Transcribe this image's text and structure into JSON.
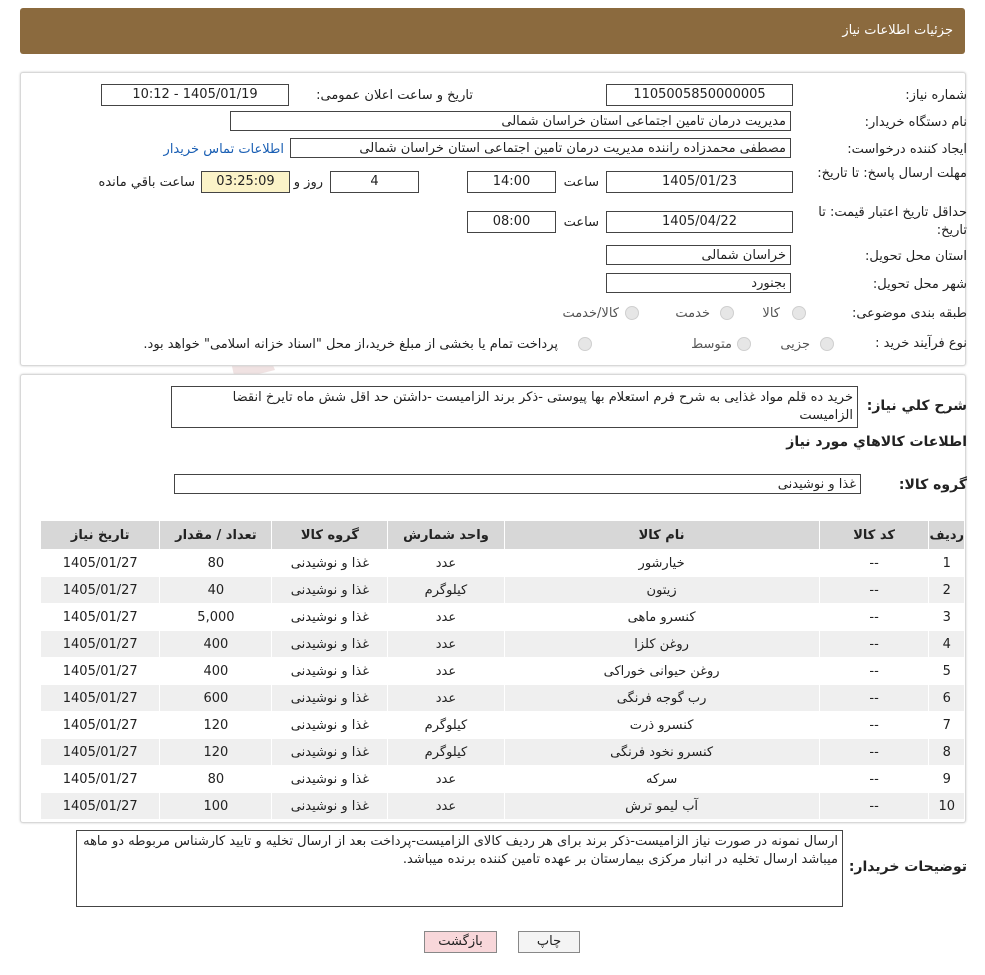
{
  "header": {
    "title": "جزئیات اطلاعات نیاز"
  },
  "fields": {
    "need_number_label": "شماره نیاز:",
    "need_number": "1105005850000005",
    "announce_label": "تاریخ و ساعت اعلان عمومی:",
    "announce_value": "1405/01/19 - 10:12",
    "buyer_org_label": "نام دستگاه خريدار:",
    "buyer_org": "مدیریت درمان تامین اجتماعی استان خراسان شمالی",
    "creator_label": "ایجاد کننده درخواست:",
    "creator": "مصطفی محمدزاده راننده مدیریت درمان تامین اجتماعی استان خراسان شمالی",
    "contact_link": "اطلاعات تماس خریدار",
    "reply_deadline_label": "مهلت ارسال پاسخ: تا تاریخ:",
    "reply_date": "1405/01/23",
    "time_label": "ساعت",
    "reply_time": "14:00",
    "days": "4",
    "days_label": "روز و",
    "remaining": "03:25:09",
    "remaining_label": "ساعت باقي مانده",
    "min_validity_label": "حداقل تاریخ اعتبار قیمت: تا تاریخ:",
    "validity_date": "1405/04/22",
    "validity_time": "08:00",
    "province_label": "استان محل تحویل:",
    "province": "خراسان شمالی",
    "city_label": "شهر محل تحویل:",
    "city": "بجنورد",
    "category_label": "طبقه بندی موضوعی:",
    "category_options": [
      "کالا",
      "خدمت",
      "کالا/خدمت"
    ],
    "process_label": "نوع فرآیند خرید :",
    "process_options": [
      "جزیی",
      "متوسط"
    ],
    "process_note": "پرداخت تمام یا بخشی از مبلغ خرید،از محل \"اسناد خزانه اسلامی\" خواهد بود."
  },
  "summary": {
    "desc_label": "شرح کلي نياز:",
    "desc": "خرید ده قلم مواد غذایی به شرح فرم استعلام بها پیوستی -ذکر برند الزامیست -داشتن حد اقل شش ماه تایرخ انقضا الزامیست",
    "goods_info_title": "اطلاعات کالاهاي مورد نياز",
    "group_label": "گروه کالا:",
    "group_value": "غذا و نوشیدنی"
  },
  "table": {
    "headers": [
      "رديف",
      "کد کالا",
      "نام کالا",
      "واحد شمارش",
      "گروه کالا",
      "تعداد / مقدار",
      "تاریخ نیاز"
    ],
    "rows": [
      [
        "1",
        "--",
        "خیارشور",
        "عدد",
        "غذا و نوشیدنی",
        "80",
        "1405/01/27"
      ],
      [
        "2",
        "--",
        "زیتون",
        "کیلوگرم",
        "غذا و نوشیدنی",
        "40",
        "1405/01/27"
      ],
      [
        "3",
        "--",
        "کنسرو ماهی",
        "عدد",
        "غذا و نوشیدنی",
        "5,000",
        "1405/01/27"
      ],
      [
        "4",
        "--",
        "روغن کلزا",
        "عدد",
        "غذا و نوشیدنی",
        "400",
        "1405/01/27"
      ],
      [
        "5",
        "--",
        "روغن حیوانی خوراکی",
        "عدد",
        "غذا و نوشیدنی",
        "400",
        "1405/01/27"
      ],
      [
        "6",
        "--",
        "رب گوجه فرنگی",
        "عدد",
        "غذا و نوشیدنی",
        "600",
        "1405/01/27"
      ],
      [
        "7",
        "--",
        "کنسرو ذرت",
        "کیلوگرم",
        "غذا و نوشیدنی",
        "120",
        "1405/01/27"
      ],
      [
        "8",
        "--",
        "کنسرو نخود فرنگی",
        "کیلوگرم",
        "غذا و نوشیدنی",
        "120",
        "1405/01/27"
      ],
      [
        "9",
        "--",
        "سرکه",
        "عدد",
        "غذا و نوشیدنی",
        "80",
        "1405/01/27"
      ],
      [
        "10",
        "--",
        "آب لیمو ترش",
        "عدد",
        "غذا و نوشیدنی",
        "100",
        "1405/01/27"
      ]
    ]
  },
  "buyer_notes": {
    "label": "توضیحات خریدار:",
    "text": "ارسال نمونه در صورت نیاز الزامیست-ذکر برند برای هر ردیف کالای الزامیست-پرداخت بعد از ارسال تخلیه و تایید کارشناس مربوطه دو ماهه میباشد ارسال تخلیه در انبار مرکزی بیمارستان بر عهده تامین کننده برنده میباشد."
  },
  "buttons": {
    "print": "چاپ",
    "back": "بازگشت"
  },
  "watermark": {
    "text": "AriaTender.neT"
  },
  "colors": {
    "header": "#8b6a3e",
    "link": "#1a5fb4",
    "back_button": "#f8d7da"
  }
}
